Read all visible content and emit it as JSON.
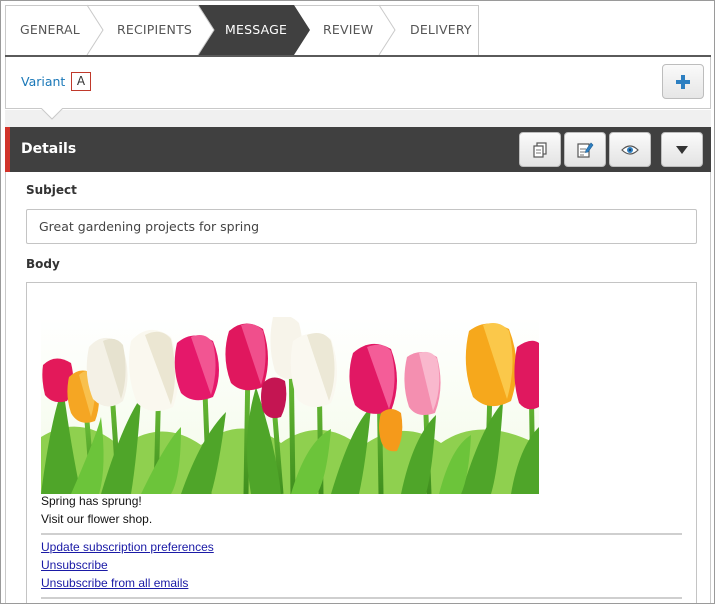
{
  "wizard": {
    "steps": [
      {
        "label": "GENERAL",
        "active": false
      },
      {
        "label": "RECIPIENTS",
        "active": false
      },
      {
        "label": "MESSAGE",
        "active": true
      },
      {
        "label": "REVIEW",
        "active": false
      },
      {
        "label": "DELIVERY",
        "active": false
      }
    ]
  },
  "variant": {
    "label": "Variant",
    "selected": "A",
    "add_icon": "plus-icon"
  },
  "details": {
    "title": "Details",
    "actions": [
      {
        "icon": "copy-icon"
      },
      {
        "icon": "edit-icon"
      },
      {
        "icon": "preview-eye-icon"
      },
      {
        "icon": "caret-down-icon"
      }
    ]
  },
  "form": {
    "subject_label": "Subject",
    "subject_value": "Great gardening projects for spring",
    "body_label": "Body"
  },
  "email": {
    "image_icon": "tulips-image",
    "line1": "Spring has sprung!",
    "line2": "Visit our flower shop.",
    "links": [
      "Update subscription preferences",
      "Unsubscribe",
      "Unsubscribe from all emails"
    ]
  },
  "colors": {
    "accent_red": "#d1332a",
    "header_dark": "#404040",
    "link_blue": "#1a78b8",
    "email_link": "#1a1aa6",
    "plus_blue": "#2d7fc1"
  }
}
